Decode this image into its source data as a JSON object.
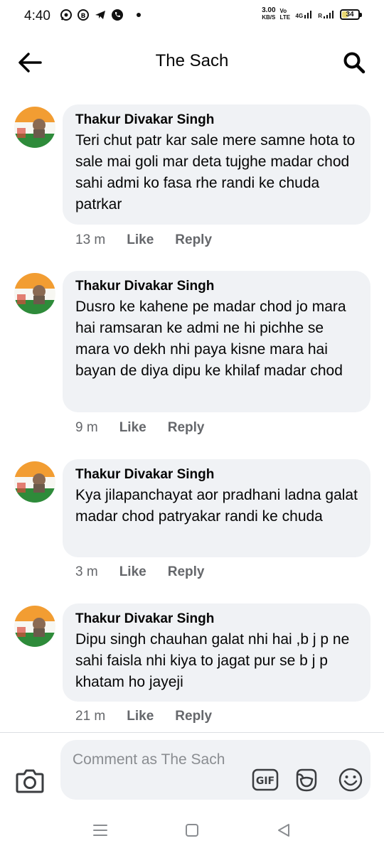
{
  "status": {
    "time": "4:40",
    "net_speed_value": "3.00",
    "net_speed_unit": "KB/S",
    "volte": "Vo LTE",
    "network": "4G",
    "roaming": "R",
    "battery": "34"
  },
  "header": {
    "title": "The Sach"
  },
  "comments": [
    {
      "author": "Thakur Divakar Singh",
      "text": "Teri chut patr kar sale mere samne hota to sale mai goli mar deta tujghe madar chod sahi admi ko fasa rhe randi ke chuda patrkar",
      "time": "13 m",
      "like": "Like",
      "reply": "Reply"
    },
    {
      "author": "Thakur Divakar Singh",
      "text": "Dusro ke kahene pe madar chod jo mara hai ramsaran ke admi ne hi pichhe se mara vo dekh nhi paya kisne mara hai bayan de diya dipu ke khilaf madar chod",
      "time": "9 m",
      "like": "Like",
      "reply": "Reply"
    },
    {
      "author": "Thakur Divakar Singh",
      "text": "Kya jilapanchayat aor pradhani ladna galat madar chod patryakar randi ke chuda",
      "time": "3 m",
      "like": "Like",
      "reply": "Reply"
    },
    {
      "author": "Thakur Divakar Singh",
      "text": "Dipu singh chauhan galat nhi hai ,b j p ne sahi  faisla nhi kiya to jagat pur se b j p khatam ho jayeji",
      "time": "21 m",
      "like": "Like",
      "reply": "Reply"
    }
  ],
  "composer": {
    "placeholder": "Comment as The Sach",
    "gif_label": "GIF"
  },
  "icons": {
    "back": "arrow-left-icon",
    "search": "search-icon",
    "camera": "camera-icon",
    "gif": "gif-icon",
    "sticker": "sticker-icon",
    "emoji": "emoji-icon",
    "nav_menu": "menu-icon",
    "nav_home": "home-square-icon",
    "nav_back": "triangle-back-icon"
  },
  "colors": {
    "bubble": "#f0f2f5",
    "meta_text": "#65676b",
    "avatar_saffron": "#f29d32",
    "avatar_green": "#2e8b3a"
  }
}
